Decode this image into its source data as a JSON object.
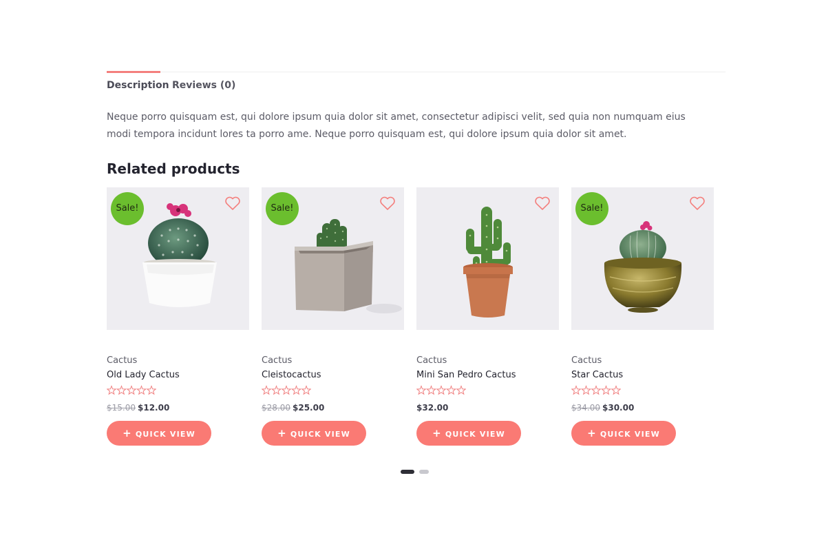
{
  "tabs": [
    {
      "label": "Description",
      "active": true
    },
    {
      "label": "Reviews (0)",
      "active": false
    }
  ],
  "description": "Neque porro quisquam est, qui dolore ipsum quia dolor sit amet, consectetur adipisci velit, sed quia non numquam eius modi tempora incidunt lores ta porro ame. Neque porro quisquam est, qui dolore ipsum quia dolor sit amet.",
  "related": {
    "title": "Related products",
    "products": [
      {
        "category": "Cactus",
        "name": "Old Lady Cactus",
        "badge": "Sale!",
        "old_price": "$15.00",
        "price": "$12.00",
        "rating": 0,
        "button": "QUICK VIEW"
      },
      {
        "category": "Cactus",
        "name": "Cleistocactus",
        "badge": "Sale!",
        "old_price": "$28.00",
        "price": "$25.00",
        "rating": 0,
        "button": "QUICK VIEW"
      },
      {
        "category": "Cactus",
        "name": "Mini San Pedro Cactus",
        "badge": "",
        "old_price": "",
        "price": "$32.00",
        "rating": 0,
        "button": "QUICK VIEW"
      },
      {
        "category": "Cactus",
        "name": "Star Cactus",
        "badge": "Sale!",
        "old_price": "$34.00",
        "price": "$30.00",
        "rating": 0,
        "button": "QUICK VIEW"
      }
    ]
  },
  "carousel": {
    "pages": 2,
    "current": 1
  },
  "icons": {
    "wishlist": "heart-outline-icon",
    "rating": "star-outline-icon",
    "add": "plus-icon"
  },
  "colors": {
    "accent": "#fa7a74",
    "sale": "#6bbe2e",
    "thumb_bg": "#eeedf1",
    "star": "#f08080"
  }
}
